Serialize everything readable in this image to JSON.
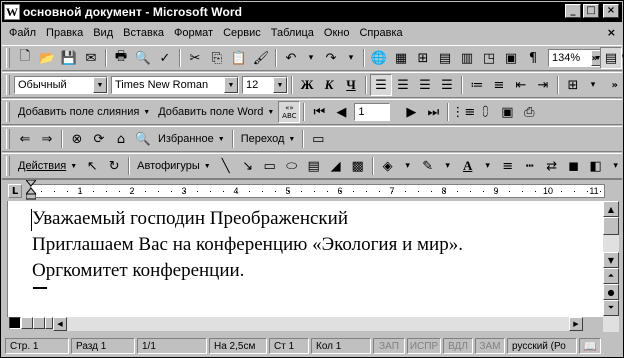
{
  "window": {
    "app_icon": "W",
    "title": "основной документ - Microsoft Word",
    "buttons": [
      "_",
      "□",
      "×"
    ]
  },
  "menu": {
    "items": [
      {
        "label": "Файл"
      },
      {
        "label": "Правка"
      },
      {
        "label": "Вид"
      },
      {
        "label": "Вставка"
      },
      {
        "label": "Формат"
      },
      {
        "label": "Сервис"
      },
      {
        "label": "Таблица"
      },
      {
        "label": "Окно"
      },
      {
        "label": "Справка"
      }
    ],
    "close_glyph": "×"
  },
  "standard_toolbar": {
    "zoom": "134%",
    "pilcrow": "¶",
    "sqrt": "√α"
  },
  "formatting_toolbar": {
    "style": "Обычный",
    "font": "Times New Roman",
    "size": "12",
    "bold": "Ж",
    "italic": "К",
    "underline": "Ч"
  },
  "mailmerge_toolbar": {
    "add_merge_field": "Добавить поле слияния",
    "add_word_field": "Добавить поле Word",
    "abc_label": "«» ABC",
    "record_number": "1"
  },
  "web_toolbar": {
    "favorites": "Избранное",
    "go": "Переход"
  },
  "drawing_toolbar": {
    "actions": "Действия",
    "autoshapes": "Автофигуры"
  },
  "ruler": {
    "corner": "L",
    "numbers": [
      "1",
      "2",
      "3",
      "4",
      "5",
      "6",
      "7",
      "8",
      "9",
      "10",
      "11"
    ]
  },
  "document": {
    "lines": [
      "Уважаемый господин Преображенский",
      "Приглашаем Вас на конференцию «Экология и мир».",
      "Оргкомитет конференции."
    ]
  },
  "status": {
    "page": "Стр. 1",
    "section": "Разд 1",
    "pages": "1/1",
    "position": "На 2,5см",
    "line": "Ст 1",
    "column": "Кол 1",
    "rec": "ЗАП",
    "trk": "ИСПР",
    "ext": "ВДЛ",
    "ovr": "ЗАМ",
    "language": "русский (Ро"
  }
}
